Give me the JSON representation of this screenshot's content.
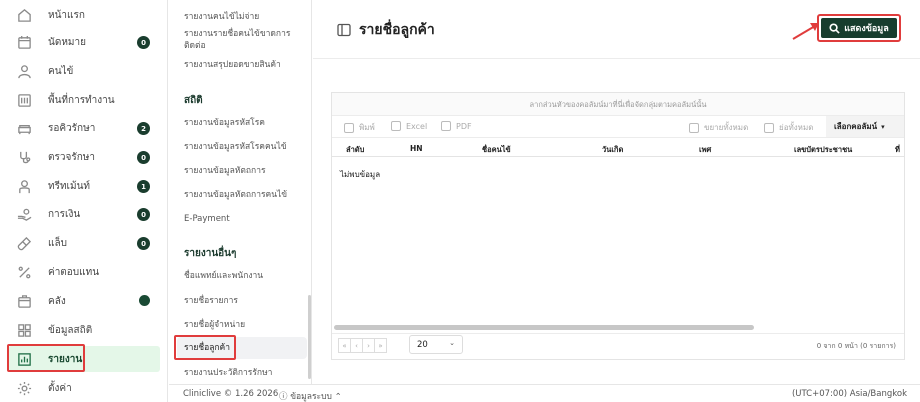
{
  "sidebar": {
    "items": [
      {
        "label": "หน้าแรก",
        "icon": "home-icon"
      },
      {
        "label": "นัดหมาย",
        "icon": "calendar-icon",
        "badge": "0"
      },
      {
        "label": "คนไข้",
        "icon": "user-icon"
      },
      {
        "label": "พื้นที่การทำงาน",
        "icon": "workspace-icon"
      },
      {
        "label": "รอคิวรักษา",
        "icon": "sofa-icon",
        "badge": "2"
      },
      {
        "label": "ตรวจรักษา",
        "icon": "stethoscope-icon",
        "badge": "0"
      },
      {
        "label": "ทรีทเม้นท์",
        "icon": "treatment-icon",
        "badge": "1"
      },
      {
        "label": "การเงิน",
        "icon": "money-hand-icon",
        "badge": "0"
      },
      {
        "label": "แล็บ",
        "icon": "test-tube-icon",
        "badge": "0"
      },
      {
        "label": "ค่าตอบแทน",
        "icon": "percent-icon"
      },
      {
        "label": "คลัง",
        "icon": "box-icon"
      },
      {
        "label": "ข้อมูลสถิติ",
        "icon": "grid-stats-icon"
      },
      {
        "label": "รายงาน",
        "icon": "report-chart-icon"
      },
      {
        "label": "ตั้งค่า",
        "icon": "gear-icon"
      }
    ]
  },
  "submenu": {
    "top_items": [
      "รายงานคนไข้ไม่จ่าย",
      "รายงานรายชื่อคนไข้ขาดการ",
      "ติดต่อ",
      "รายงานสรุปยอดขายสินค้า"
    ],
    "section1_title": "สถิติ",
    "section1_items": [
      "รายงานข้อมูลรหัสโรค",
      "รายงานข้อมูลรหัสโรคคนไข้",
      "รายงานข้อมูลหัตถการ",
      "รายงานข้อมูลหัตถการคนไข้",
      "E-Payment"
    ],
    "section2_title": "รายงานอื่นๆ",
    "section2_items": [
      "ชื่อแพทย์และพนักงาน",
      "รายชื่อรายการ",
      "รายชื่อผู้จำหน่าย",
      "รายชื่อลูกค้า",
      "รายงานประวัติการรักษา"
    ]
  },
  "footer": {
    "version": "Cliniclive © 1.26 2026",
    "system_info": "ข้อมูลระบบ",
    "timezone": "(UTC+07:00) Asia/Bangkok"
  },
  "main": {
    "title": "รายชื่อลูกค้า",
    "show_button": "แสดงข้อมูล",
    "group_hint": "ลากส่วนหัวของคอลัมน์มาที่นี่เพื่อจัดกลุ่มตามคอลัมน์นั้น",
    "toolbar": {
      "print": "พิมพ์",
      "excel": "Excel",
      "pdf": "PDF",
      "expand_all": "ขยายทั้งหมด",
      "collapse_all": "ย่อทั้งหมด",
      "column_chooser": "เลือกคอลัมน์"
    },
    "columns": [
      "ลำดับ",
      "HN",
      "ชื่อคนไข้",
      "วันเกิด",
      "เพศ",
      "เลขบัตรประชาชน",
      "ที่"
    ],
    "no_data": "ไม่พบข้อมูล",
    "pager": {
      "first": "«",
      "prev": "‹",
      "next": "›",
      "last": "»",
      "page_size": "20",
      "info": "0 จาก 0 หน้า (0 รายการ)"
    }
  },
  "colors": {
    "accent": "#173d2e",
    "active_bg": "#e4f7e8",
    "highlight": "#e03c3c"
  }
}
